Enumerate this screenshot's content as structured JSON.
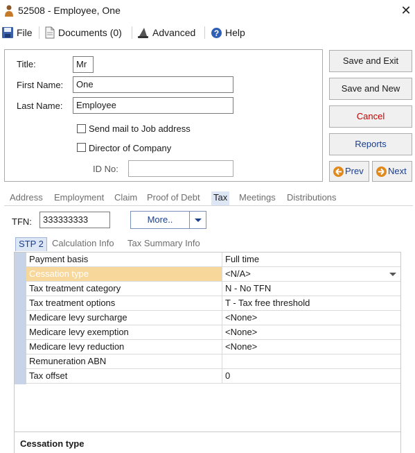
{
  "window": {
    "title": "52508 - Employee, One",
    "close_glyph": "✕"
  },
  "menu": {
    "file": "File",
    "documents": "Documents (0)",
    "advanced": "Advanced",
    "help": "Help"
  },
  "details": {
    "title_label": "Title:",
    "title_value": "Mr",
    "first_name_label": "First Name:",
    "first_name_value": "One",
    "last_name_label": "Last Name:",
    "last_name_value": "Employee",
    "send_mail_label": "Send mail to Job address",
    "director_label": "Director of Company",
    "id_no_label": "ID No:",
    "id_no_value": ""
  },
  "actions": {
    "save_exit": "Save and Exit",
    "save_new": "Save and New",
    "cancel": "Cancel",
    "reports": "Reports",
    "prev": "Prev",
    "next": "Next"
  },
  "tabs": [
    "Address",
    "Employment",
    "Claim",
    "Proof of Debt",
    "Tax",
    "Meetings",
    "Distributions"
  ],
  "active_tab": "Tax",
  "tfn": {
    "label": "TFN:",
    "value": "333333333",
    "more": "More.."
  },
  "subtabs": [
    "STP 2",
    "Calculation Info",
    "Tax Summary Info"
  ],
  "active_subtab": "STP 2",
  "properties": [
    {
      "name": "Payment basis",
      "value": "Full time"
    },
    {
      "name": "Cessation type",
      "value": "<N/A>"
    },
    {
      "name": "Tax treatment category",
      "value": "N - No TFN"
    },
    {
      "name": "Tax treatment options",
      "value": "T - Tax free threshold"
    },
    {
      "name": "Medicare levy surcharge",
      "value": "<None>"
    },
    {
      "name": "Medicare levy exemption",
      "value": "<None>"
    },
    {
      "name": "Medicare levy reduction",
      "value": "<None>"
    },
    {
      "name": "Remuneration ABN",
      "value": ""
    },
    {
      "name": "Tax offset",
      "value": "0"
    }
  ],
  "description_title": "Cessation type",
  "colors": {
    "accent_blue": "#1a3e8c",
    "cancel_red": "#c00000",
    "selected_row": "#f7d79a",
    "nav_orange": "#e08a1e"
  }
}
